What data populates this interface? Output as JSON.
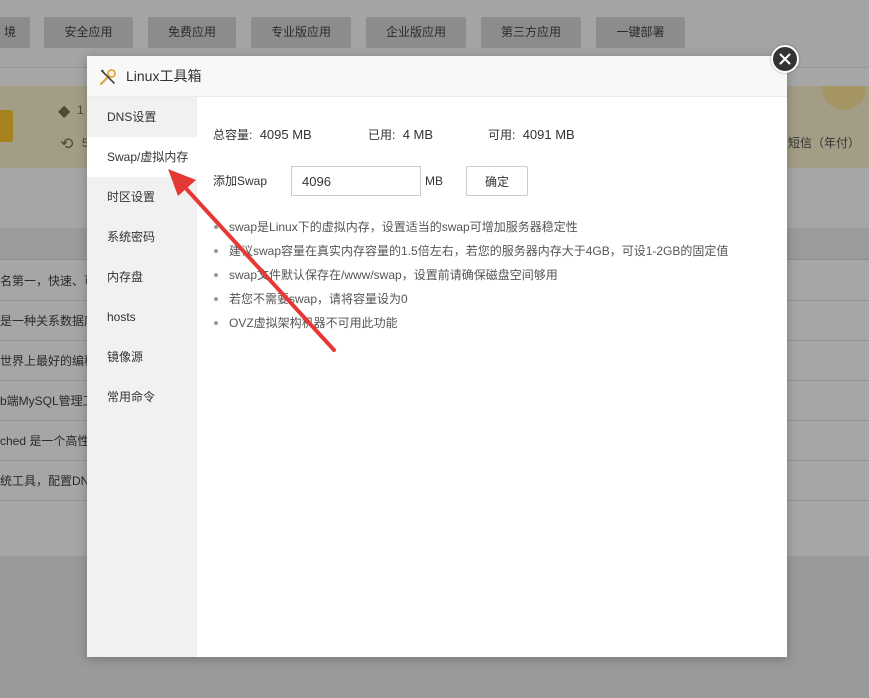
{
  "background": {
    "tabs": [
      {
        "label": "境"
      },
      {
        "label": "安全应用"
      },
      {
        "label": "免费应用"
      },
      {
        "label": "专业版应用"
      },
      {
        "label": "企业版应用"
      },
      {
        "label": "第三方应用"
      },
      {
        "label": "一键部署"
      }
    ],
    "banner_right_text": "短信（年付）",
    "banner_line1_fragment": "1",
    "banner_line2_fragment": "5",
    "rows": [
      {
        "text": "名第一，快速、可"
      },
      {
        "text": "是一种关系数据库"
      },
      {
        "text": "世界上最好的编程"
      },
      {
        "text": "b端MySQL管理工"
      },
      {
        "text": "ched 是一个高性"
      },
      {
        "text": "统工具，配置DN"
      }
    ]
  },
  "modal": {
    "title": "Linux工具箱",
    "menu": [
      {
        "label": "DNS设置"
      },
      {
        "label": "Swap/虚拟内存"
      },
      {
        "label": "时区设置"
      },
      {
        "label": "系统密码"
      },
      {
        "label": "内存盘"
      },
      {
        "label": "hosts"
      },
      {
        "label": "镜像源"
      },
      {
        "label": "常用命令"
      }
    ],
    "active_menu": "Swap/虚拟内存",
    "stats": {
      "total_label": "总容量:",
      "total_value": "4095 MB",
      "used_label": "已用:",
      "used_value": "4 MB",
      "free_label": "可用:",
      "free_value": "4091 MB"
    },
    "swap": {
      "label": "添加Swap",
      "value": "4096",
      "unit": "MB",
      "confirm_label": "确定"
    },
    "tips": [
      "swap是Linux下的虚拟内存，设置适当的swap可增加服务器稳定性",
      "建议swap容量在真实内存容量的1.5倍左右，若您的服务器内存大于4GB，可设1-2GB的固定值",
      "swap文件默认保存在/www/swap，设置前请确保磁盘空间够用",
      "若您不需要swap，请将容量设为0",
      "OVZ虚拟架构机器不可用此功能"
    ]
  },
  "colors": {
    "arrow": "#e53935",
    "overlay": "#9a9a9a"
  }
}
